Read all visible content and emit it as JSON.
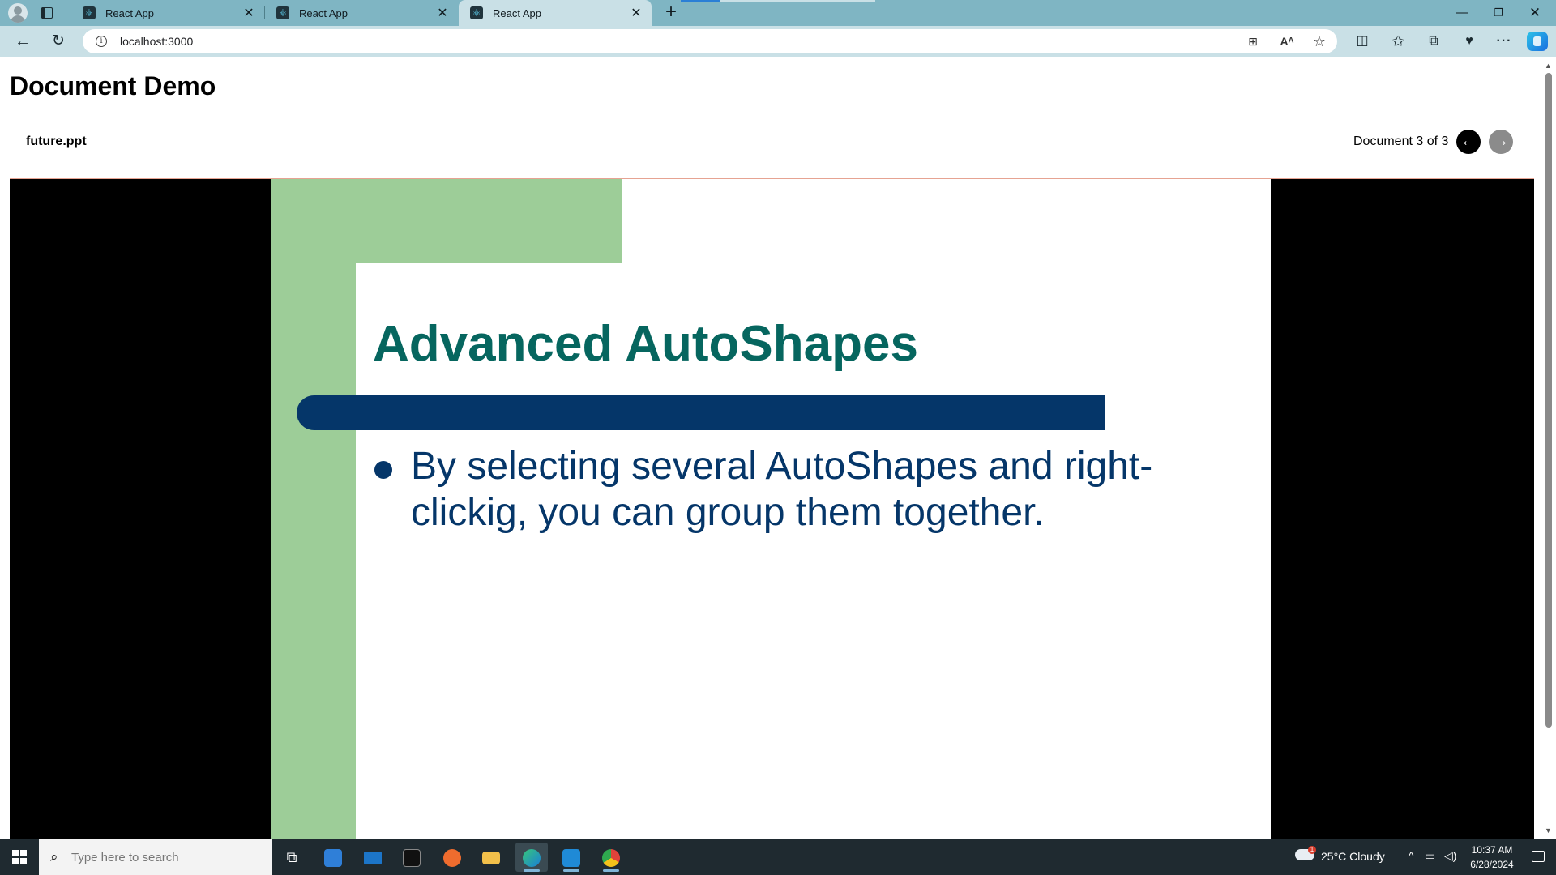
{
  "browser": {
    "tabs": [
      {
        "title": "React App"
      },
      {
        "title": "React App"
      },
      {
        "title": "React App"
      }
    ],
    "address": "localhost:3000"
  },
  "page": {
    "title": "Document Demo",
    "filename": "future.ppt",
    "document_counter": "Document 3 of 3"
  },
  "slide": {
    "title": "Advanced AutoShapes",
    "bullet": "By selecting several AutoShapes and right-clickig, you can group them together.",
    "colors": {
      "title": "#06665f",
      "body": "#053669",
      "accent_bar": "#053669",
      "green_panel": "#9dcd98"
    }
  },
  "taskbar": {
    "search_placeholder": "Type here to search",
    "weather": "25°C  Cloudy",
    "time": "10:37 AM",
    "date": "6/28/2024"
  }
}
